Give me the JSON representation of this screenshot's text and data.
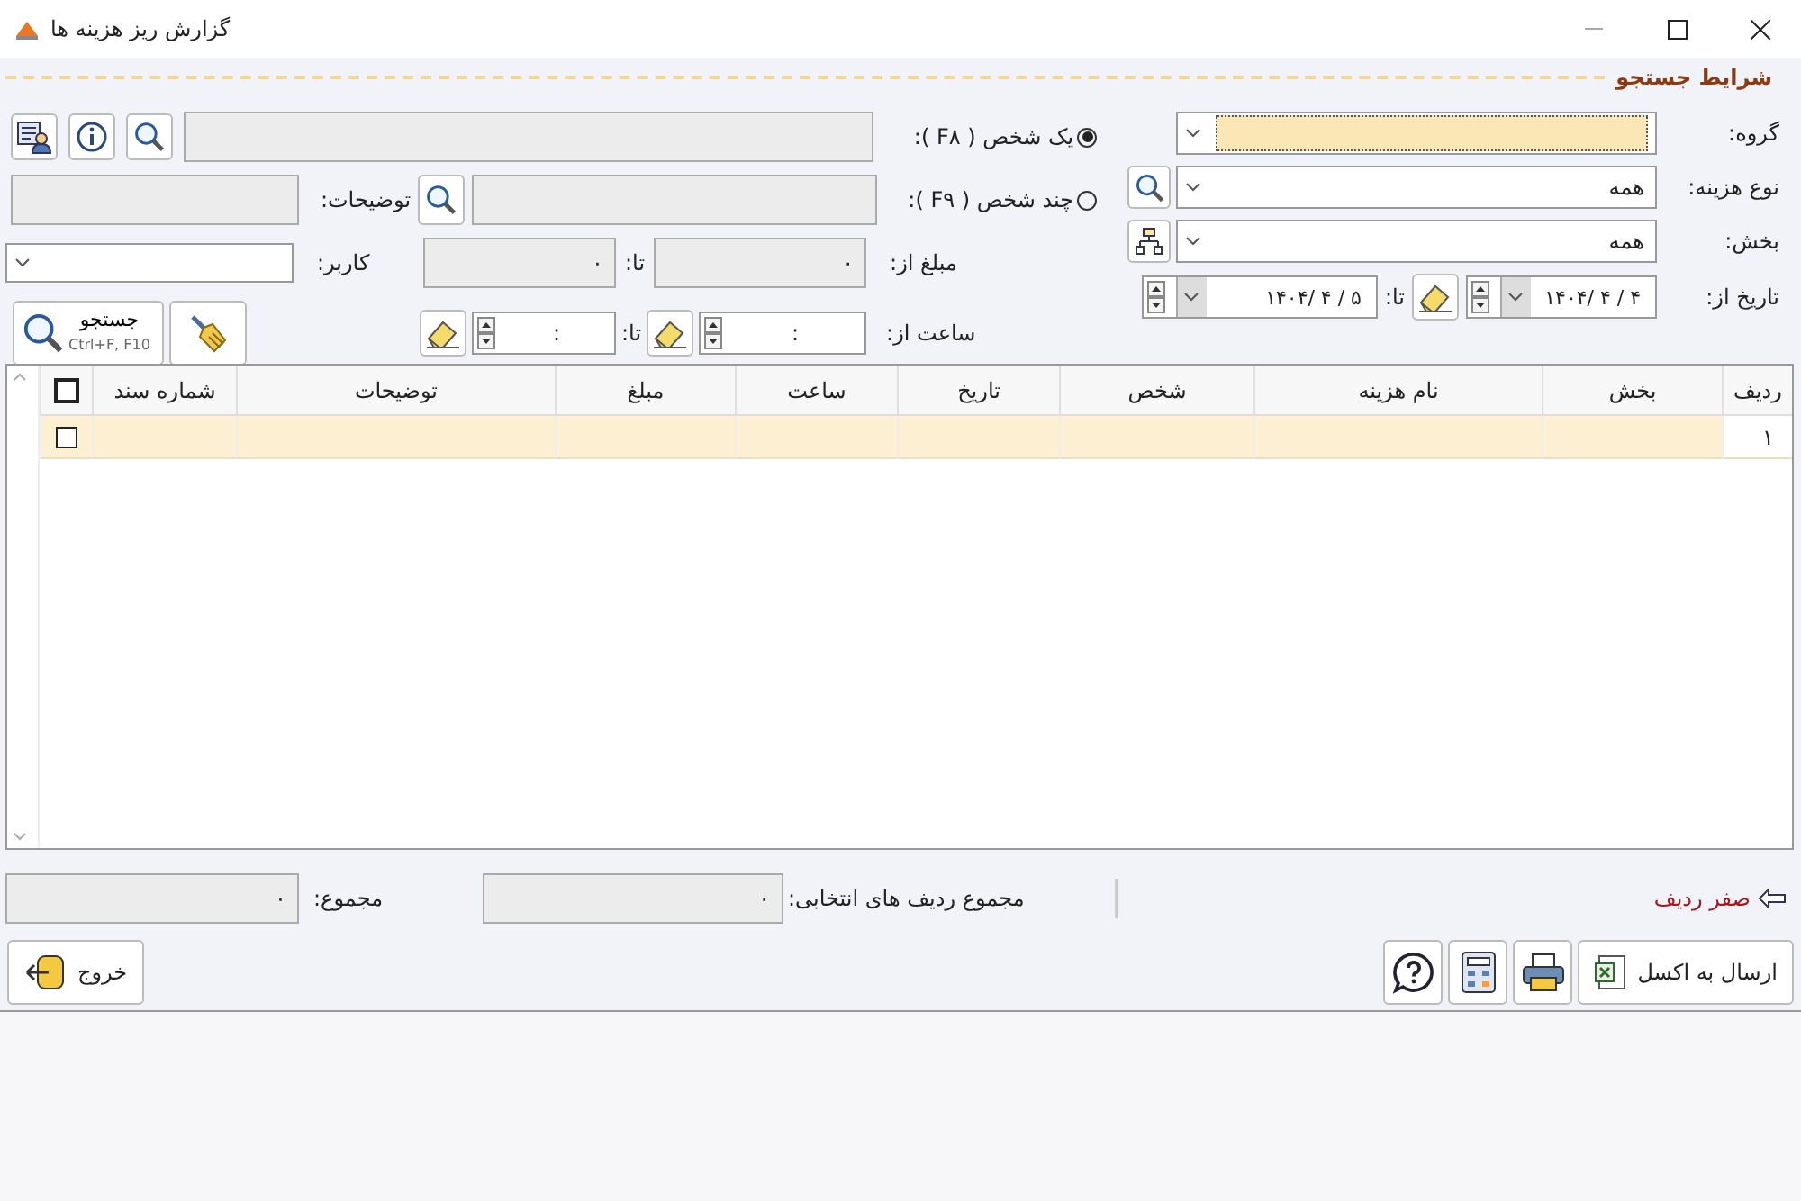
{
  "window": {
    "title": "گزارش ریز هزینه ها"
  },
  "search": {
    "title": "شرایط جستجو",
    "group": {
      "label": "گروه:"
    },
    "expense_type": {
      "label": "نوع هزینه:",
      "value": "همه"
    },
    "department": {
      "label": "بخش:",
      "value": "همه"
    },
    "date": {
      "label": "تاریخ از:",
      "from": "۱۴۰۴/ ۴ / ۴",
      "to_label": "تا:",
      "to": "۱۴۰۴/ ۴ / ۵"
    },
    "person_mode": [
      {
        "label": "یک شخص ( F۸ ):",
        "selected": true
      },
      {
        "label": "چند شخص ( F۹ ):",
        "selected": false
      }
    ],
    "description": {
      "label": "توضیحات:"
    },
    "amount": {
      "label": "مبلغ از:",
      "from": "۰",
      "to_label": "تا:",
      "to": "۰"
    },
    "user": {
      "label": "کاربر:"
    },
    "time": {
      "label": "ساعت از:",
      "from": ":",
      "to_label": "تا:",
      "to": ":"
    },
    "search_button": {
      "label": "جستجو",
      "shortcut": "Ctrl+F, F10"
    }
  },
  "table": {
    "header_checkbox": {
      "checked": false
    },
    "columns": [
      "ردیف",
      "بخش",
      "نام هزینه",
      "شخص",
      "تاریخ",
      "ساعت",
      "مبلغ",
      "توضیحات",
      "شماره سند"
    ],
    "rows": [
      {
        "row_number": "۱",
        "checked": false
      }
    ]
  },
  "footer": {
    "zero_rows": "صفر ردیف",
    "selected_sum": {
      "label": "مجموع ردیف های انتخابی:",
      "value": "۰"
    },
    "total": {
      "label": "مجموع:",
      "value": "۰"
    },
    "excel_button": "ارسال به اکسل",
    "exit_button": "خروج"
  }
}
